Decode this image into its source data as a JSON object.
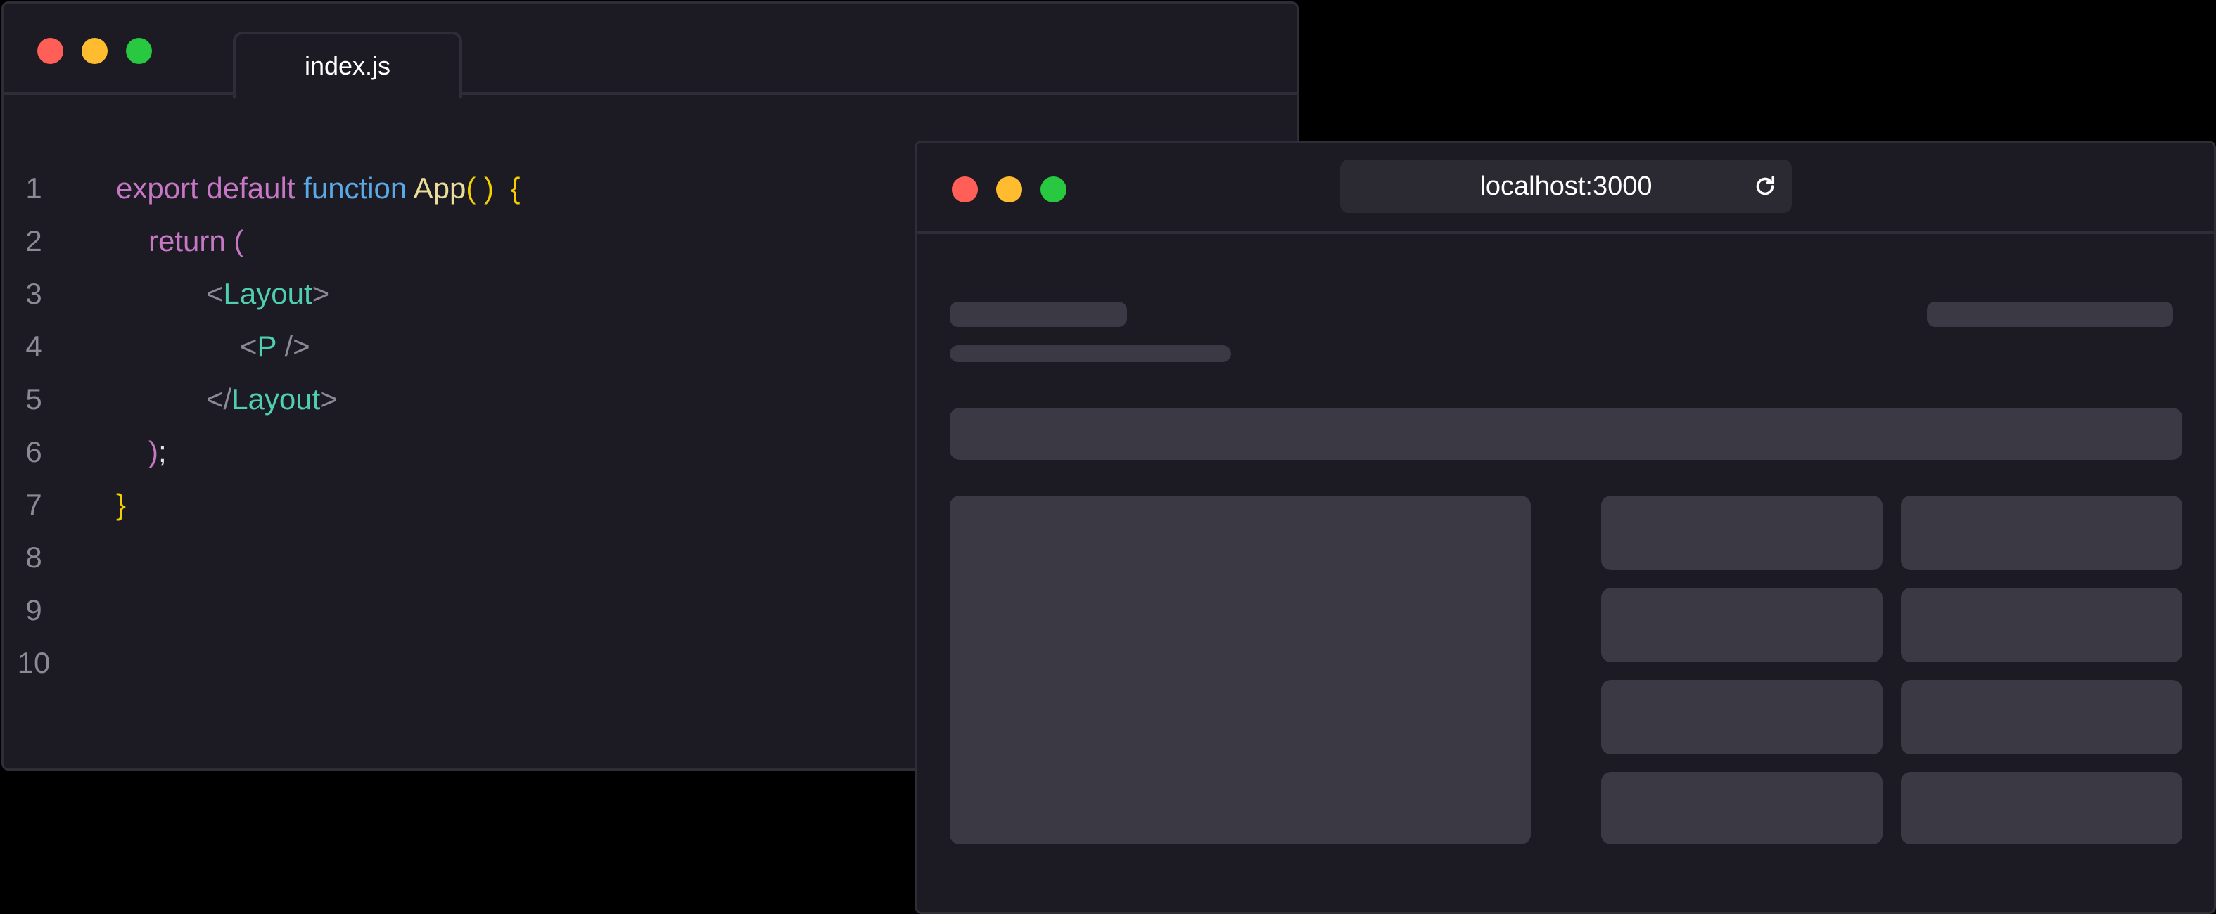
{
  "editor": {
    "tab_label": "index.js",
    "lines": [
      {
        "num": "1",
        "tokens": [
          {
            "t": "export default ",
            "c": "kw"
          },
          {
            "t": "function ",
            "c": "fn"
          },
          {
            "t": "App",
            "c": "name"
          },
          {
            "t": "( )",
            "c": "brace"
          },
          {
            "t": "  {",
            "c": "brace"
          }
        ]
      },
      {
        "num": "2",
        "tokens": [
          {
            "t": "return (",
            "c": "kw"
          }
        ]
      },
      {
        "num": "3",
        "tokens": [
          {
            "t": "<",
            "c": "punct"
          },
          {
            "t": "Layout",
            "c": "tag"
          },
          {
            "t": ">",
            "c": "punct"
          }
        ]
      },
      {
        "num": "4",
        "tokens": [
          {
            "t": "<",
            "c": "punct"
          },
          {
            "t": "P",
            "c": "tag"
          },
          {
            "t": " />",
            "c": "punct"
          }
        ]
      },
      {
        "num": "5",
        "tokens": [
          {
            "t": "</",
            "c": "punct"
          },
          {
            "t": "Layout",
            "c": "tag"
          },
          {
            "t": ">",
            "c": "punct"
          }
        ]
      },
      {
        "num": "6",
        "tokens": [
          {
            "t": ")",
            "c": "kw"
          },
          {
            "t": ";",
            "c": "semi"
          }
        ]
      },
      {
        "num": "7",
        "tokens": [
          {
            "t": "}",
            "c": "brace"
          }
        ]
      },
      {
        "num": "8",
        "tokens": []
      },
      {
        "num": "9",
        "tokens": []
      },
      {
        "num": "10",
        "tokens": []
      }
    ]
  },
  "browser": {
    "address": "localhost:3000",
    "reload_icon": "reload-icon"
  },
  "colors": {
    "window_bg": "#1c1b24",
    "border": "#2f2e38",
    "skeleton": "#3a3944",
    "traffic_red": "#ff5f57",
    "traffic_yellow": "#febc2e",
    "traffic_green": "#28c840"
  }
}
